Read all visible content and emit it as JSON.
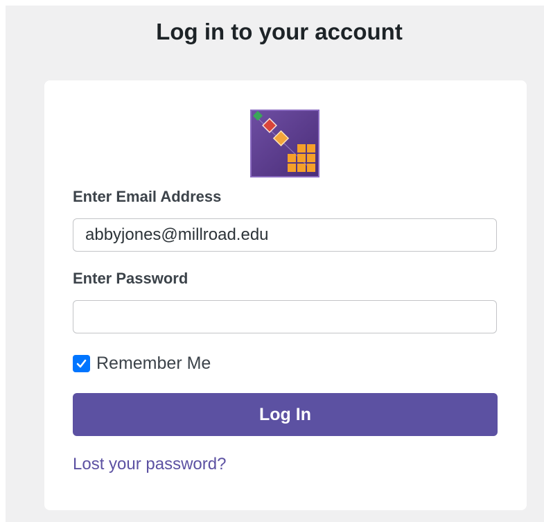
{
  "title": "Log in to your account",
  "logo": {
    "icon": "grid-app-logo",
    "colors": {
      "background": "#5e3e8f",
      "border": "#8a6bc0",
      "tile": "#f5a02a",
      "diamond_red": "#d9453a",
      "diamond_orange": "#f3a53a",
      "diamond_green": "#3aa659"
    }
  },
  "form": {
    "email_label": "Enter Email Address",
    "email_value": "abbyjones@millroad.edu",
    "password_label": "Enter Password",
    "password_value": "",
    "remember_label": "Remember Me",
    "remember_checked": true,
    "submit_label": "Log In",
    "lost_password_label": "Lost your password?"
  },
  "colors": {
    "page_background": "#f0f0f1",
    "accent": "#5c51a2",
    "checkbox": "#0075ff"
  }
}
